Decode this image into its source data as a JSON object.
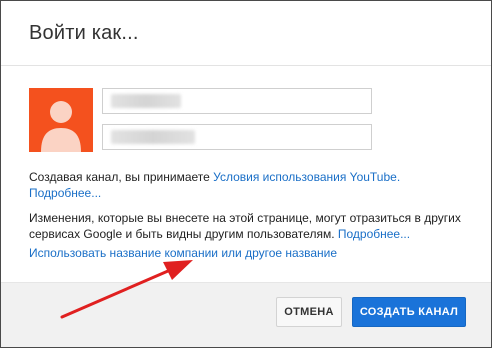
{
  "dialog": {
    "title": "Войти как..."
  },
  "account": {
    "first_name_value": "",
    "last_name_value": ""
  },
  "terms": {
    "prefix": "Создавая канал, вы принимаете ",
    "link": "Условия использования YouTube.",
    "more": "Подробнее..."
  },
  "info": {
    "text": "Изменения, которые вы внесете на этой странице, могут отразиться в других сервисах Google и быть видны другим пользователям. ",
    "more": "Подробнее..."
  },
  "alt_name_link": "Использовать название компании или другое название",
  "buttons": {
    "cancel": "ОТМЕНА",
    "create": "СОЗДАТЬ КАНАЛ"
  },
  "colors": {
    "avatar_bg": "#f4511e",
    "link": "#1a6fc7",
    "primary_button": "#1a73d9",
    "annotation_arrow": "#e02020"
  },
  "icons": {
    "avatar": "person-icon"
  }
}
